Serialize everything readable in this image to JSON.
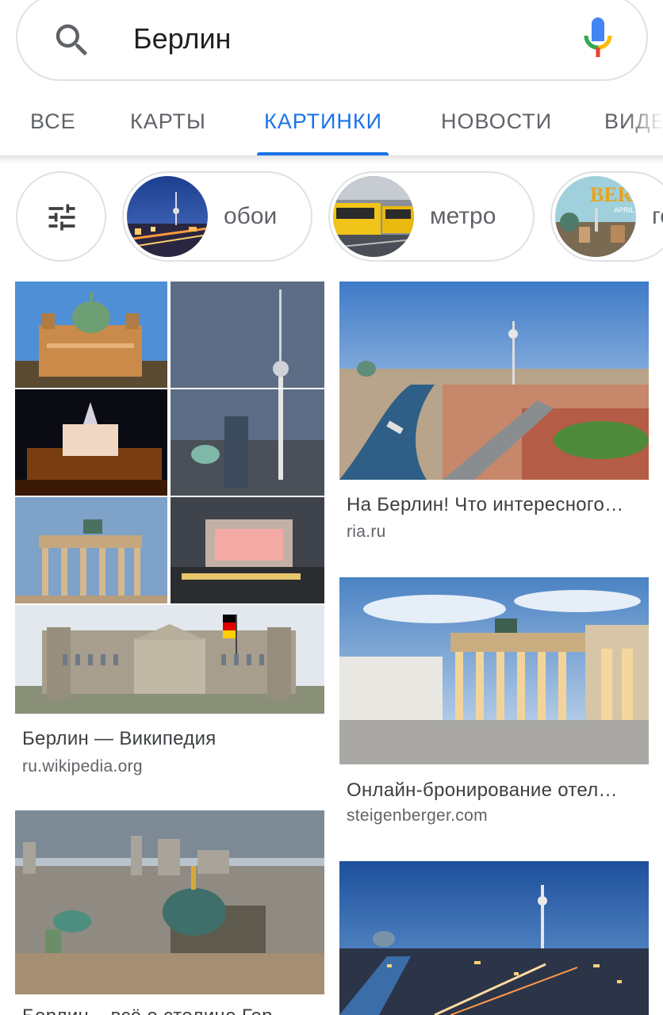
{
  "search": {
    "query": "Берлин"
  },
  "tabs": [
    {
      "label": "ВСЕ",
      "active": false
    },
    {
      "label": "КАРТЫ",
      "active": false
    },
    {
      "label": "КАРТИНКИ",
      "active": true
    },
    {
      "label": "НОВОСТИ",
      "active": false
    },
    {
      "label": "ВИДЕ",
      "active": false
    }
  ],
  "chips": [
    {
      "label": "обои",
      "icon": "city-night-thumbnail"
    },
    {
      "label": "метро",
      "icon": "yellow-train-thumbnail"
    },
    {
      "label": "го",
      "icon": "berlin-poster-thumbnail"
    }
  ],
  "results": [
    {
      "title": "Берлин — Википедия",
      "domain": "ru.wikipedia.org"
    },
    {
      "title": "На Берлин! Что интересного…",
      "domain": "ria.ru"
    },
    {
      "title": "Онлайн-бронирование отел…",
      "domain": "steigenberger.com"
    },
    {
      "title": "Берлин – всё о столице Гер",
      "domain": ""
    }
  ],
  "colors": {
    "accent": "#1a73e8",
    "tab_inactive": "#5f6368",
    "border": "#dfe1e5"
  }
}
